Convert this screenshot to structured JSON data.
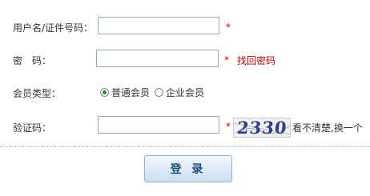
{
  "form": {
    "username_label": "用户名/证件号码：",
    "password_label": "密　码：",
    "member_type_label": "会员类型：",
    "captcha_label": "验证码：",
    "required_mark": "*",
    "forgot_password_link": "找回密码",
    "member_type_options": [
      "普通会员",
      "企业会员"
    ],
    "member_type_selected": "普通会员",
    "captcha_image_text": "2330",
    "captcha_refresh_link": "看不清楚,换一个",
    "login_button": "登 录",
    "username_value": "",
    "password_value": "",
    "captcha_value": ""
  },
  "colors": {
    "required": "#d40000",
    "link": "#c00000",
    "input_border": "#8eaac7",
    "button_text": "#1f4e79"
  }
}
